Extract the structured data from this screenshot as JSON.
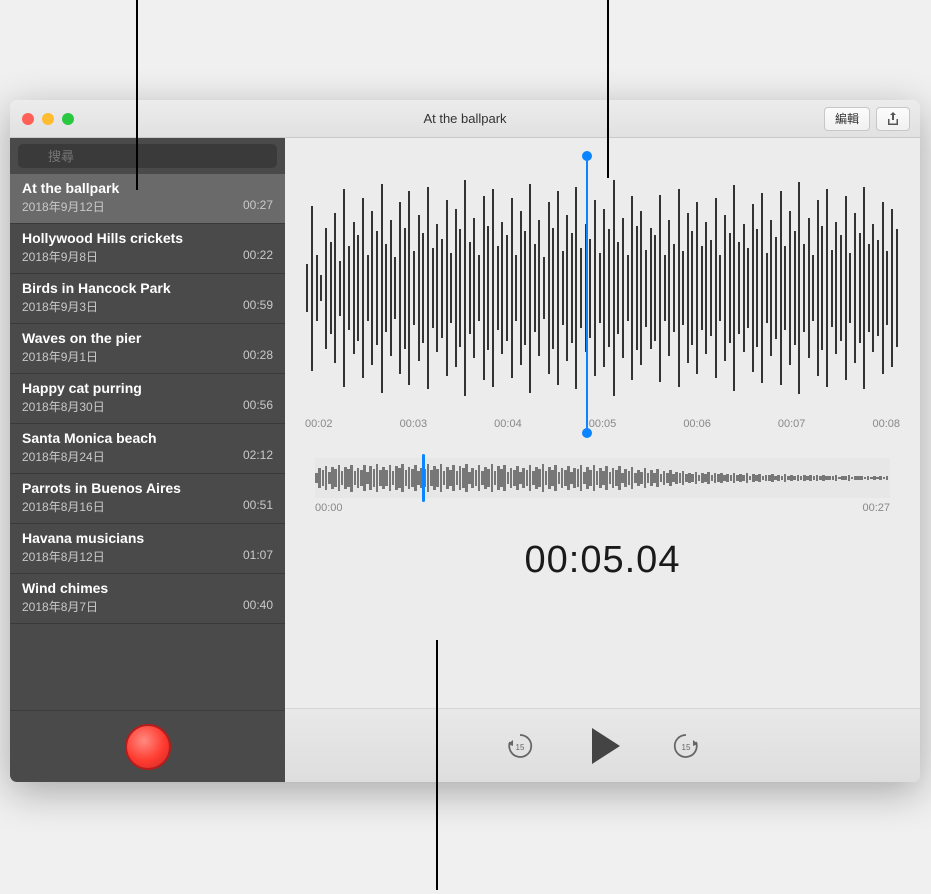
{
  "window": {
    "title": "At the ballpark",
    "edit_label": "編輯"
  },
  "search": {
    "placeholder": "搜尋"
  },
  "recordings": [
    {
      "title": "At the ballpark",
      "date": "2018年9月12日",
      "duration": "00:27",
      "selected": true
    },
    {
      "title": "Hollywood Hills crickets",
      "date": "2018年9月8日",
      "duration": "00:22",
      "selected": false
    },
    {
      "title": "Birds in Hancock Park",
      "date": "2018年9月3日",
      "duration": "00:59",
      "selected": false
    },
    {
      "title": "Waves on the pier",
      "date": "2018年9月1日",
      "duration": "00:28",
      "selected": false
    },
    {
      "title": "Happy cat purring",
      "date": "2018年8月30日",
      "duration": "00:56",
      "selected": false
    },
    {
      "title": "Santa Monica beach",
      "date": "2018年8月24日",
      "duration": "02:12",
      "selected": false
    },
    {
      "title": "Parrots in Buenos Aires",
      "date": "2018年8月16日",
      "duration": "00:51",
      "selected": false
    },
    {
      "title": "Havana musicians",
      "date": "2018年8月12日",
      "duration": "01:07",
      "selected": false
    },
    {
      "title": "Wind chimes",
      "date": "2018年8月7日",
      "duration": "00:40",
      "selected": false
    }
  ],
  "zoom_ruler": [
    "00:02",
    "00:03",
    "00:04",
    "00:05",
    "00:06",
    "00:07",
    "00:08"
  ],
  "overview": {
    "start": "00:00",
    "end": "00:27"
  },
  "current_time": "00:05.04",
  "chart_data": {
    "type": "bar",
    "title": "Audio waveform amplitude",
    "playhead_time_seconds": 5.04,
    "total_duration_seconds": 27,
    "zoom_window_seconds": [
      1.5,
      8.5
    ],
    "zoom_bars_normalized": [
      0.22,
      0.75,
      0.3,
      0.12,
      0.55,
      0.42,
      0.68,
      0.25,
      0.9,
      0.38,
      0.6,
      0.48,
      0.82,
      0.3,
      0.7,
      0.52,
      0.95,
      0.4,
      0.62,
      0.28,
      0.78,
      0.55,
      0.88,
      0.34,
      0.66,
      0.5,
      0.92,
      0.36,
      0.58,
      0.45,
      0.8,
      0.32,
      0.72,
      0.54,
      0.98,
      0.42,
      0.64,
      0.3,
      0.84,
      0.56,
      0.9,
      0.38,
      0.6,
      0.48,
      0.82,
      0.3,
      0.7,
      0.52,
      0.95,
      0.4,
      0.62,
      0.28,
      0.78,
      0.55,
      0.88,
      0.34,
      0.66,
      0.5,
      0.92,
      0.36,
      0.58,
      0.45,
      0.8,
      0.32,
      0.72,
      0.54,
      0.98,
      0.42,
      0.64,
      0.3,
      0.84,
      0.56,
      0.7,
      0.35,
      0.55,
      0.48,
      0.85,
      0.3,
      0.62,
      0.4,
      0.9,
      0.34,
      0.68,
      0.52,
      0.78,
      0.38,
      0.6,
      0.44,
      0.82,
      0.3,
      0.66,
      0.5,
      0.94,
      0.42,
      0.58,
      0.36,
      0.76,
      0.54,
      0.86,
      0.32,
      0.62,
      0.46,
      0.88,
      0.38,
      0.7,
      0.52,
      0.96,
      0.4,
      0.64,
      0.3,
      0.8,
      0.56,
      0.9,
      0.35,
      0.6,
      0.48,
      0.84,
      0.32,
      0.68,
      0.5,
      0.92,
      0.4,
      0.58,
      0.44,
      0.78,
      0.34,
      0.72,
      0.54
    ],
    "overview_bars_normalized": [
      0.3,
      0.55,
      0.42,
      0.68,
      0.35,
      0.6,
      0.48,
      0.72,
      0.38,
      0.62,
      0.5,
      0.75,
      0.4,
      0.58,
      0.45,
      0.7,
      0.36,
      0.64,
      0.52,
      0.78,
      0.42,
      0.6,
      0.46,
      0.72,
      0.38,
      0.66,
      0.54,
      0.8,
      0.44,
      0.62,
      0.48,
      0.74,
      0.4,
      0.58,
      0.5,
      0.76,
      0.42,
      0.64,
      0.52,
      0.78,
      0.38,
      0.6,
      0.46,
      0.72,
      0.4,
      0.66,
      0.54,
      0.8,
      0.36,
      0.58,
      0.44,
      0.7,
      0.38,
      0.62,
      0.5,
      0.76,
      0.4,
      0.64,
      0.48,
      0.74,
      0.36,
      0.56,
      0.42,
      0.68,
      0.34,
      0.58,
      0.46,
      0.72,
      0.38,
      0.62,
      0.5,
      0.76,
      0.4,
      0.6,
      0.44,
      0.7,
      0.35,
      0.56,
      0.42,
      0.66,
      0.34,
      0.58,
      0.48,
      0.72,
      0.36,
      0.6,
      0.46,
      0.7,
      0.38,
      0.54,
      0.4,
      0.64,
      0.32,
      0.56,
      0.42,
      0.66,
      0.3,
      0.5,
      0.38,
      0.6,
      0.28,
      0.46,
      0.34,
      0.54,
      0.26,
      0.42,
      0.3,
      0.48,
      0.24,
      0.38,
      0.28,
      0.44,
      0.22,
      0.34,
      0.26,
      0.4,
      0.2,
      0.3,
      0.24,
      0.36,
      0.18,
      0.28,
      0.22,
      0.32,
      0.16,
      0.26,
      0.2,
      0.3,
      0.15,
      0.24,
      0.18,
      0.28,
      0.14,
      0.22,
      0.17,
      0.26,
      0.13,
      0.2,
      0.16,
      0.24,
      0.12,
      0.18,
      0.14,
      0.22,
      0.11,
      0.17,
      0.13,
      0.2,
      0.1,
      0.16,
      0.12,
      0.18,
      0.1,
      0.15,
      0.11,
      0.17,
      0.09,
      0.14,
      0.1,
      0.16,
      0.09,
      0.13,
      0.1,
      0.15,
      0.08,
      0.12,
      0.09,
      0.14,
      0.08,
      0.11,
      0.09,
      0.13,
      0.07,
      0.11,
      0.08,
      0.12,
      0.07,
      0.1,
      0.08,
      0.11
    ]
  }
}
